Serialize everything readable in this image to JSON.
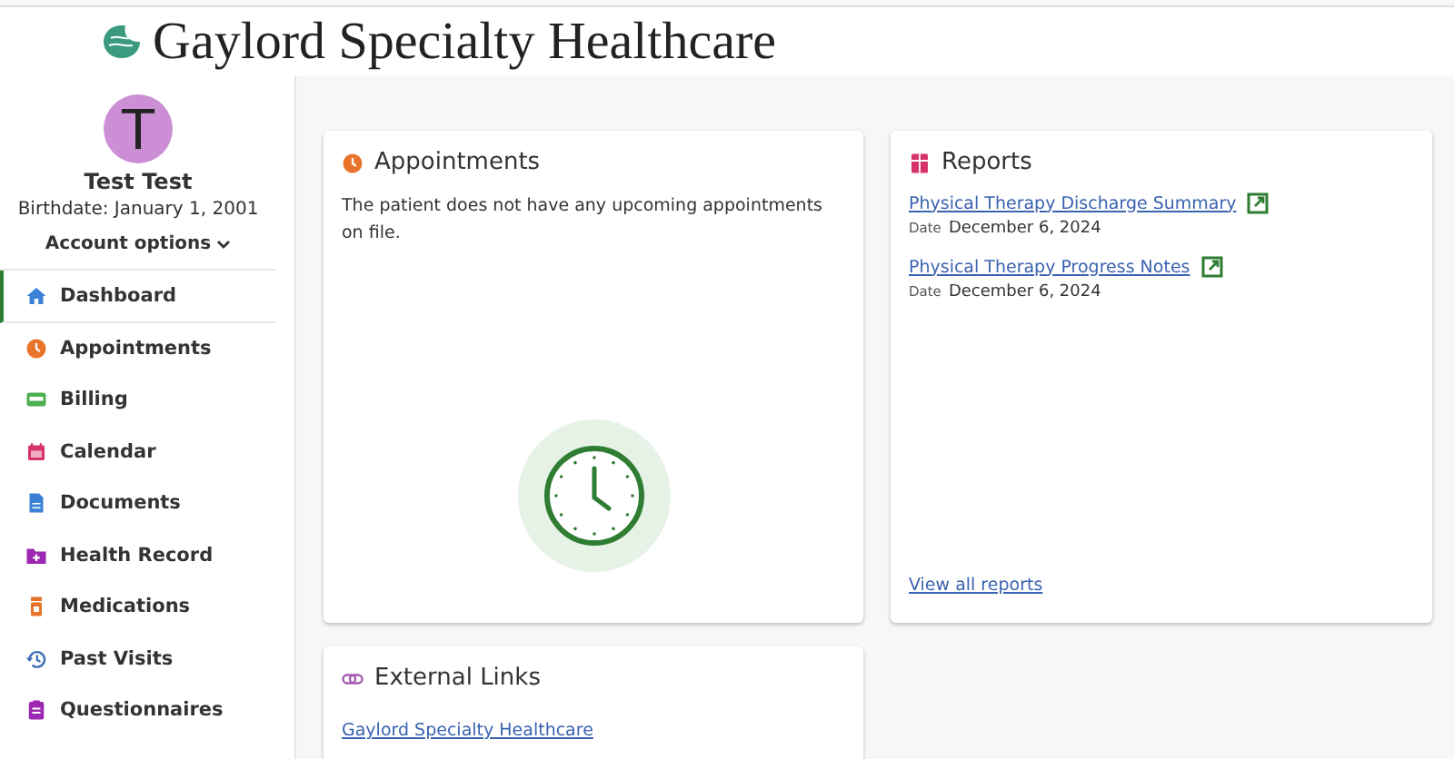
{
  "header": {
    "logo_text": "Gaylord Specialty Healthcare"
  },
  "profile": {
    "initial": "T",
    "name": "Test Test",
    "birthdate": "Birthdate: January 1, 2001",
    "account_options": "Account options"
  },
  "sidebar": {
    "items": [
      {
        "label": "Dashboard",
        "kind": "home",
        "selected": true
      },
      {
        "label": "Appointments",
        "kind": "clock",
        "selected": false
      },
      {
        "label": "Billing",
        "kind": "card",
        "selected": false
      },
      {
        "label": "Calendar",
        "kind": "calendar",
        "selected": false
      },
      {
        "label": "Documents",
        "kind": "document",
        "selected": false
      },
      {
        "label": "Health Record",
        "kind": "folder",
        "selected": false
      },
      {
        "label": "Medications",
        "kind": "bottle",
        "selected": false
      },
      {
        "label": "Past Visits",
        "kind": "history",
        "selected": false
      },
      {
        "label": "Questionnaires",
        "kind": "clipboard",
        "selected": false
      }
    ]
  },
  "appointments": {
    "title": "Appointments",
    "message": "The patient does not have any upcoming appointments on file."
  },
  "reports": {
    "title": "Reports",
    "items": [
      {
        "title": "Physical Therapy Discharge Summary",
        "date_label": "Date",
        "date": "December 6, 2024"
      },
      {
        "title": "Physical Therapy Progress Notes",
        "date_label": "Date",
        "date": "December 6, 2024"
      }
    ],
    "view_all": "View all reports"
  },
  "external_links": {
    "title": "External Links",
    "links": [
      "Gaylord Specialty Healthcare"
    ]
  }
}
